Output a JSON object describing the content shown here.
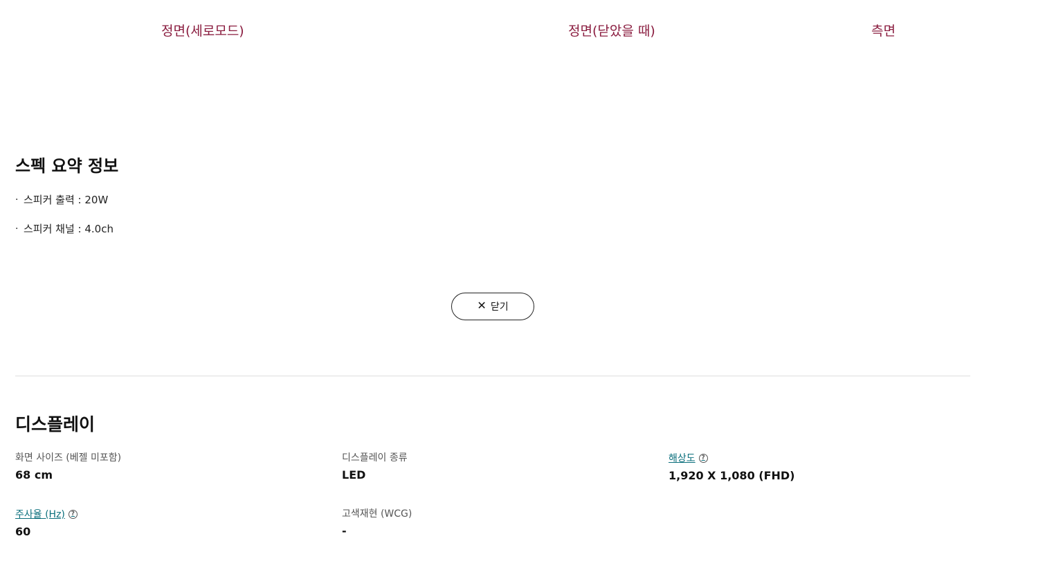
{
  "view_tabs": [
    "정면(세로모드)",
    "정면(닫았을 때)",
    "측면"
  ],
  "summary": {
    "title": "스펙 요약 정보",
    "items": [
      "스피커 출력 : 20W",
      "스피커 채널 : 4.0ch"
    ]
  },
  "close_button": {
    "label": "닫기",
    "icon": "close-icon"
  },
  "display_section": {
    "title": "디스플레이",
    "specs": [
      {
        "label": "화면 사이즈 (베젤 미포함)",
        "value": "68 cm",
        "link": false
      },
      {
        "label": "디스플레이 종류",
        "value": "LED",
        "link": false
      },
      {
        "label": "해상도",
        "value": "1,920 X 1,080 (FHD)",
        "link": true,
        "help": "?"
      },
      {
        "label": "주사율 (Hz)",
        "value": "60",
        "link": true,
        "help": "?"
      },
      {
        "label": "고색재현 (WCG)",
        "value": "-",
        "link": false
      }
    ]
  },
  "colors": {
    "tab": "#8a1c3f",
    "link": "#0b6f7c",
    "divider": "#dddddd"
  }
}
